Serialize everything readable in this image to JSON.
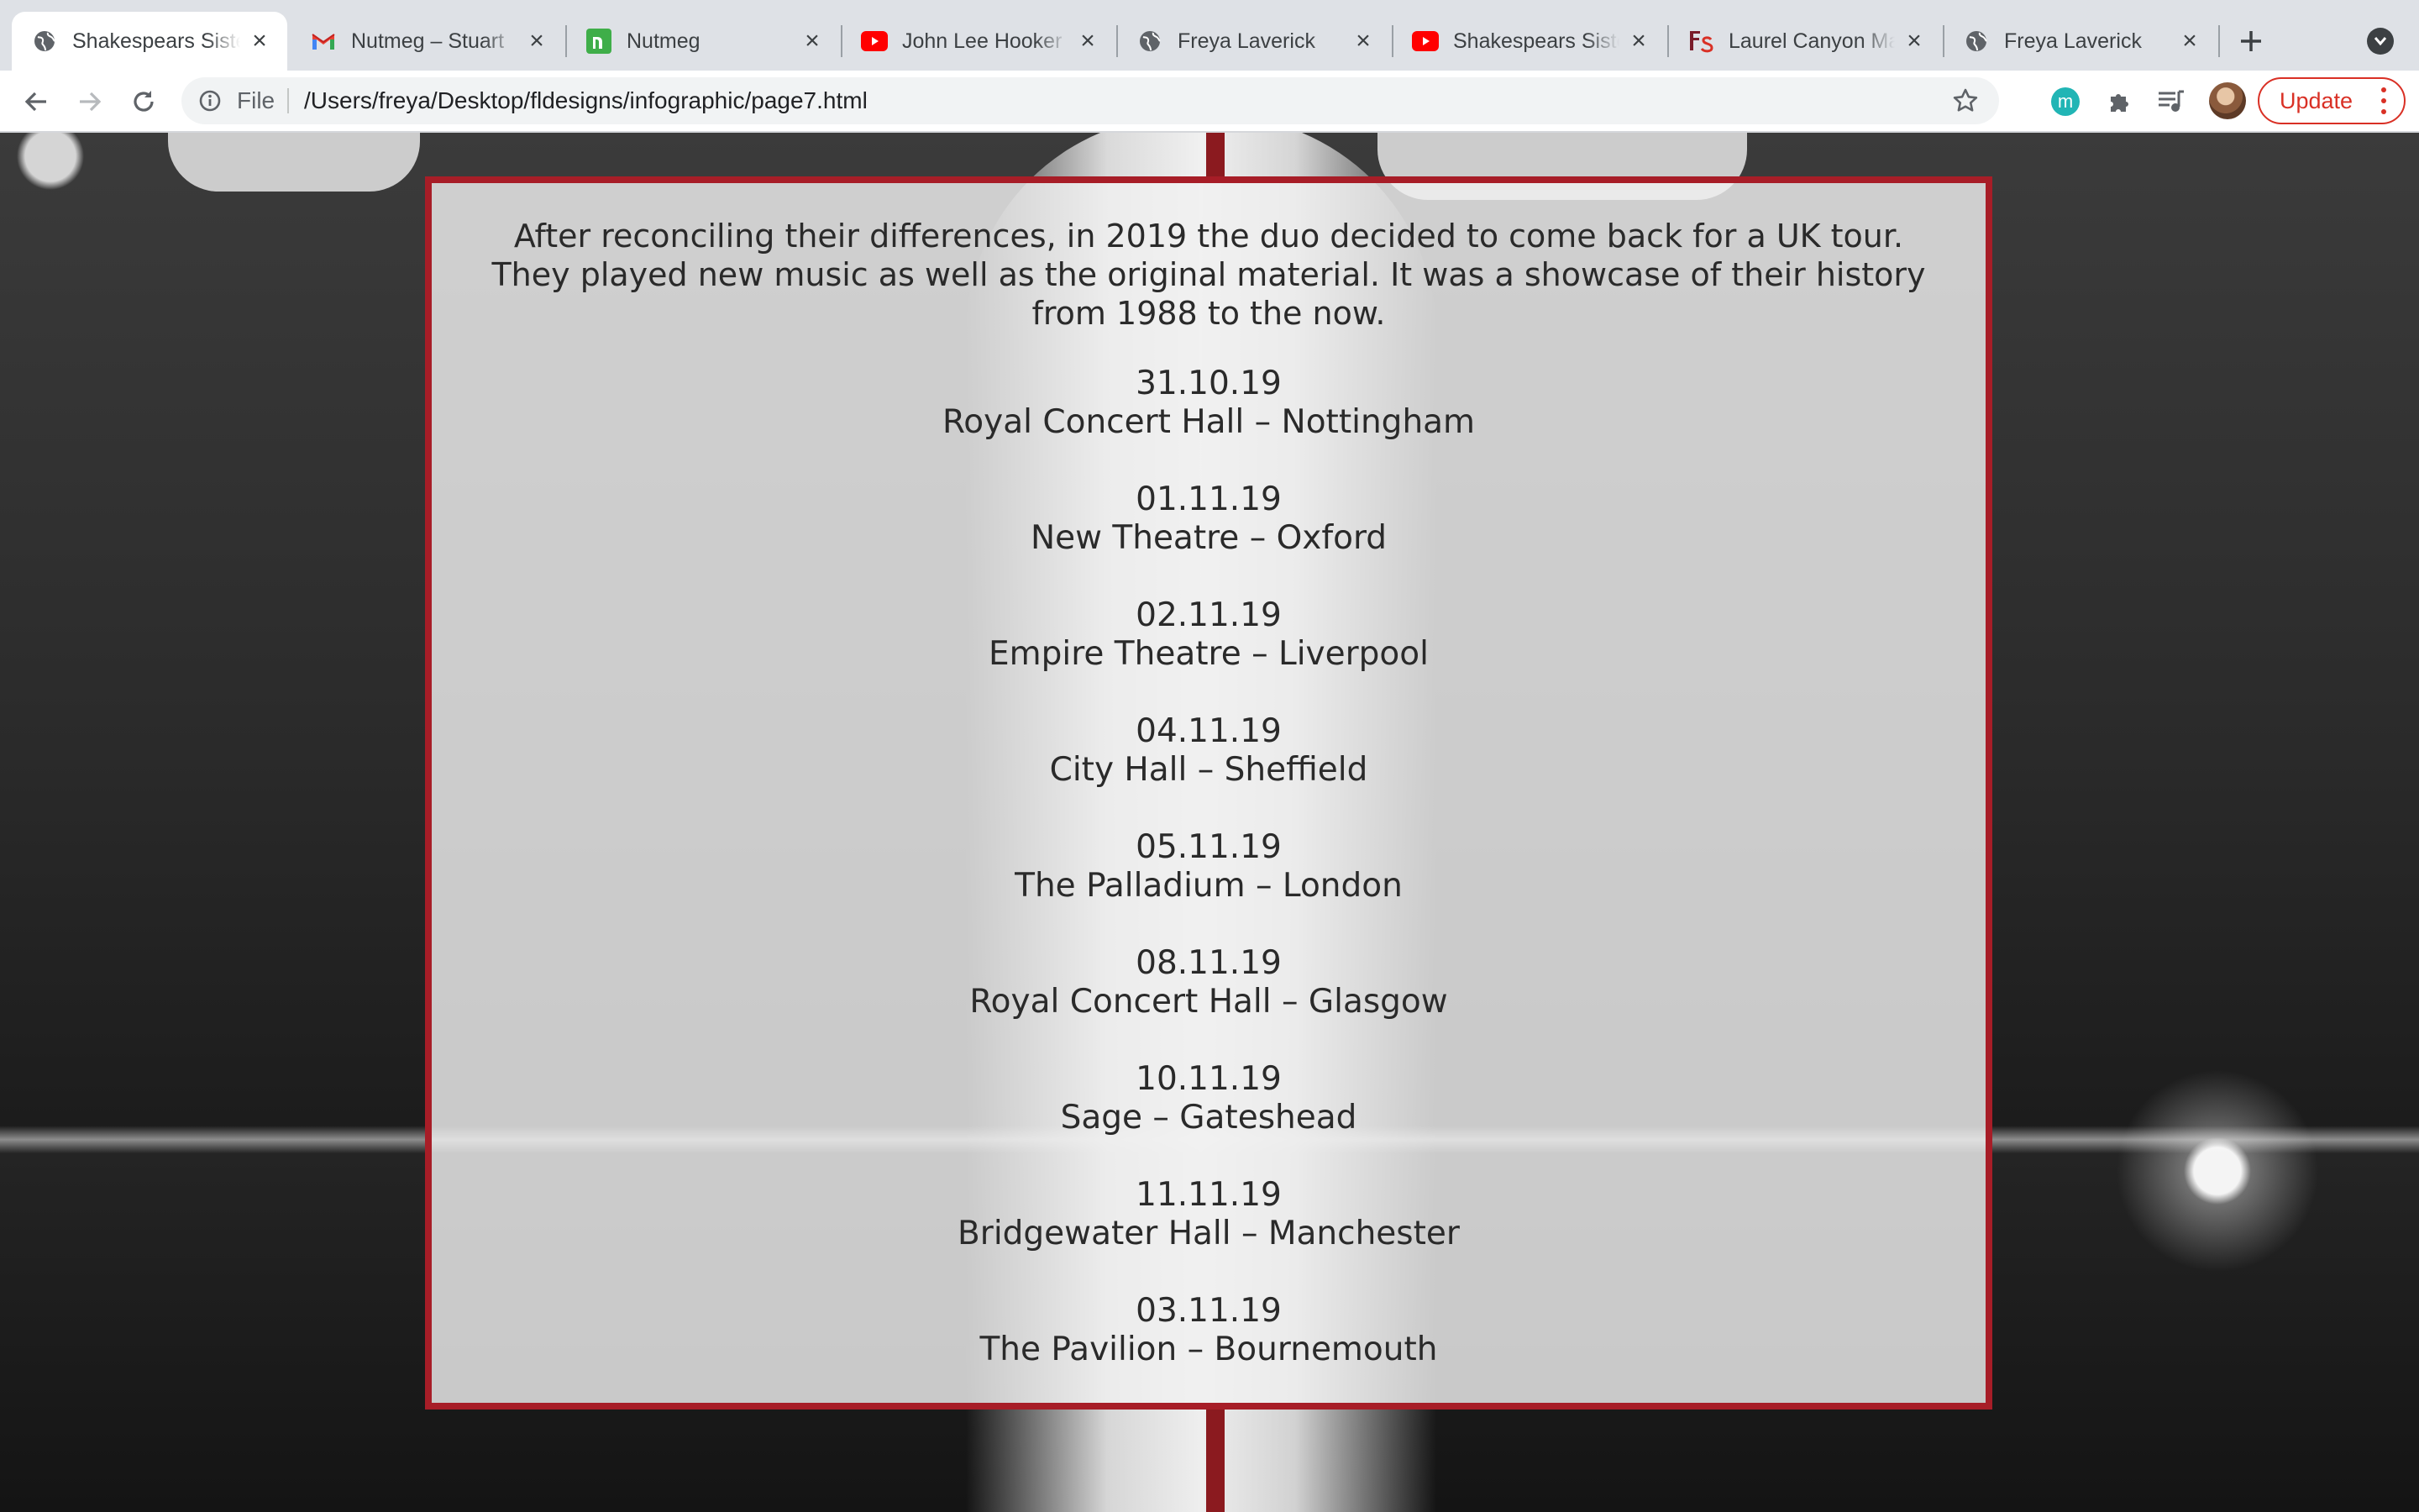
{
  "browser": {
    "tabs": [
      {
        "title": "Shakespears Sister",
        "icon": "globe-icon",
        "active": true
      },
      {
        "title": "Nutmeg – Stuart",
        "icon": "gmail-icon",
        "active": false
      },
      {
        "title": "Nutmeg",
        "icon": "nutmeg-icon",
        "active": false
      },
      {
        "title": "John Lee Hooker",
        "icon": "youtube-icon",
        "active": false
      },
      {
        "title": "Freya Laverick",
        "icon": "globe-icon",
        "active": false
      },
      {
        "title": "Shakespears Sister",
        "icon": "youtube-icon",
        "active": false
      },
      {
        "title": "Laurel Canyon Ma",
        "icon": "fs-icon",
        "active": false
      },
      {
        "title": "Freya Laverick",
        "icon": "globe-icon",
        "active": false
      }
    ],
    "address": {
      "scheme_label": "File",
      "url": "/Users/freya/Desktop/fldesigns/infographic/page7.html"
    },
    "extension_m_label": "m",
    "update_label": "Update",
    "colors": {
      "accent_red": "#d93025",
      "tab_bar": "#dee1e6"
    }
  },
  "page": {
    "intro": "After reconciling their differences, in 2019 the duo decided to come back for a UK tour. They played new music as well as the original material. It was a showcase of their history from 1988 to the now.",
    "dates": [
      {
        "date": "31.10.19",
        "venue": "Royal Concert Hall – Nottingham"
      },
      {
        "date": "01.11.19",
        "venue": "New Theatre – Oxford"
      },
      {
        "date": "02.11.19",
        "venue": "Empire Theatre – Liverpool"
      },
      {
        "date": "04.11.19",
        "venue": "City Hall – Sheffield"
      },
      {
        "date": "05.11.19",
        "venue": "The Palladium – London"
      },
      {
        "date": "08.11.19",
        "venue": "Royal Concert Hall – Glasgow"
      },
      {
        "date": "10.11.19",
        "venue": "Sage – Gateshead"
      },
      {
        "date": "11.11.19",
        "venue": "Bridgewater Hall – Manchester"
      },
      {
        "date": "03.11.19",
        "venue": "The Pavilion – Bournemouth"
      }
    ],
    "colors": {
      "panel_border": "#a71d27",
      "text": "#2a2a2a"
    }
  }
}
